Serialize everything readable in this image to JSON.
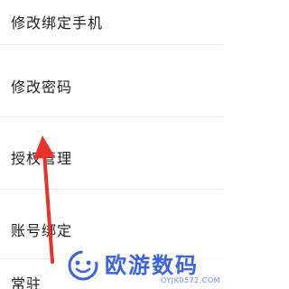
{
  "menu": {
    "items": [
      {
        "label": "修改绑定手机"
      },
      {
        "label": "修改密码"
      },
      {
        "label": "授权管理"
      },
      {
        "label": "账号绑定"
      },
      {
        "label": "常驻"
      }
    ]
  },
  "watermark": {
    "title": "欧游数码",
    "url": "OYJK0572.COM"
  },
  "colors": {
    "arrow": "#e8332a",
    "watermark": "#3a63e3",
    "divider": "#ececec"
  }
}
